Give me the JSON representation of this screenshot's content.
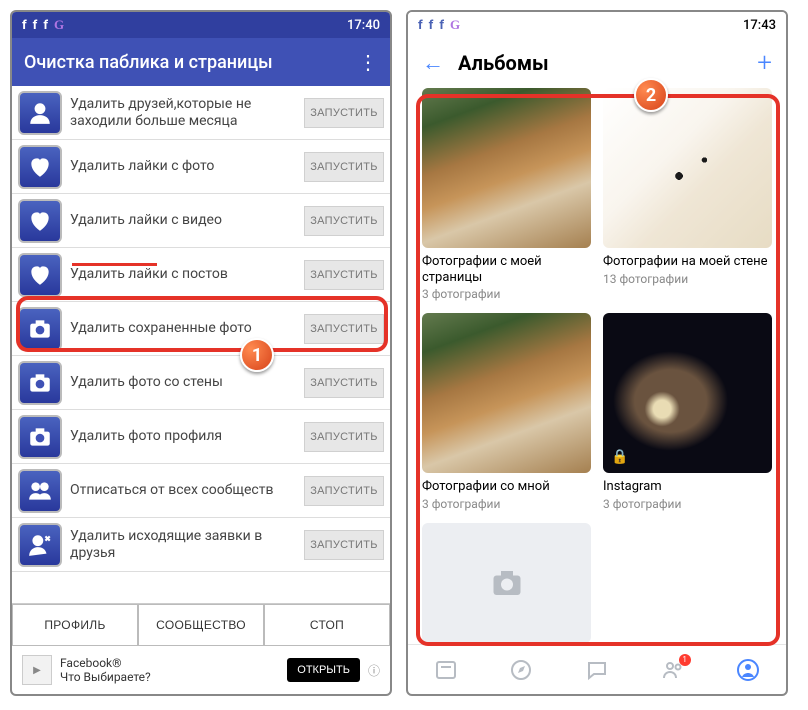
{
  "left": {
    "status_time": "17:40",
    "title": "Очистка паблика и страницы",
    "items": [
      {
        "label": "Удалить друзей,которые не заходили больше месяца",
        "btn": "ЗАПУСТИТЬ",
        "icon": "person"
      },
      {
        "label": "Удалить лайки с фото",
        "btn": "ЗАПУСТИТЬ",
        "icon": "heart"
      },
      {
        "label": "Удалить лайки с видео",
        "btn": "ЗАПУСТИТЬ",
        "icon": "heart"
      },
      {
        "label": "Удалить лайки с постов",
        "btn": "ЗАПУСТИТЬ",
        "icon": "heart"
      },
      {
        "label": "Удалить сохраненные фото",
        "btn": "ЗАПУСТИТЬ",
        "icon": "camera"
      },
      {
        "label": "Удалить фото со стены",
        "btn": "ЗАПУСТИТЬ",
        "icon": "camera"
      },
      {
        "label": "Удалить фото профиля",
        "btn": "ЗАПУСТИТЬ",
        "icon": "camera"
      },
      {
        "label": "Отписаться от всех сообществ",
        "btn": "ЗАПУСТИТЬ",
        "icon": "group"
      },
      {
        "label": "Удалить исходящие заявки в друзья",
        "btn": "ЗАПУСТИТЬ",
        "icon": "person-x"
      }
    ],
    "tabs": {
      "profile": "ПРОФИЛЬ",
      "community": "СООБЩЕСТВО",
      "stop": "СТОП"
    },
    "ad": {
      "brand": "Facebook®",
      "line": "Что Выбираете?",
      "open": "ОТКРЫТЬ"
    }
  },
  "right": {
    "status_time": "17:43",
    "title": "Альбомы",
    "albums": [
      {
        "title": "Фотографии с моей страницы",
        "count": "3 фотографии",
        "thumb": "dog"
      },
      {
        "title": "Фотографии на моей стене",
        "count": "13 фотографии",
        "thumb": "fox"
      },
      {
        "title": "Фотографии со мной",
        "count": "3 фотографии",
        "thumb": "dog"
      },
      {
        "title": "Instagram",
        "count": "3 фотографии",
        "thumb": "galaxy"
      }
    ],
    "nav_badge": "1"
  },
  "annotations": {
    "step1": "1",
    "step2": "2"
  }
}
